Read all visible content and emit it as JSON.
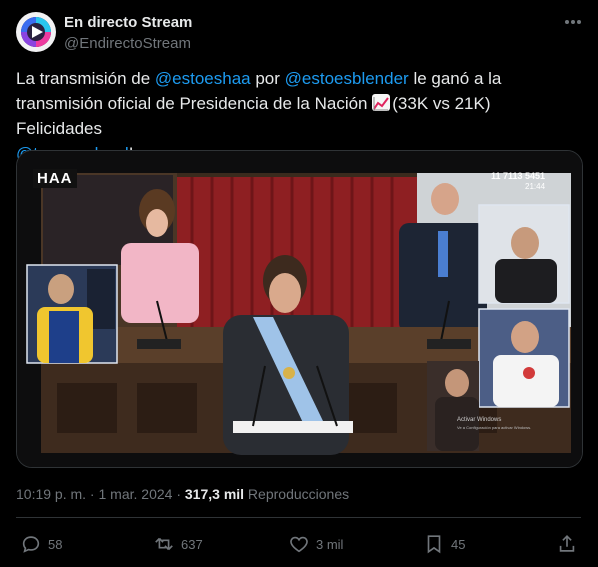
{
  "author": {
    "name": "En directo Stream",
    "handle": "@EndirectoStream"
  },
  "tweet": {
    "t1": "La transmisión de ",
    "m1": "@estoeshaa",
    "t2": " por ",
    "m2": "@estoesblender",
    "t3": " le ganó a la transmisión oficial de Presidencia de la Nación ",
    "t4": "(33K vs 21K) Felicidades",
    "m3": "@tomasrebord",
    "t5": "!"
  },
  "media": {
    "logo_text": "HAA",
    "phone_text": "11 7113 5451",
    "clock_text": "21:44",
    "watermark_line1": "Activar Windows",
    "watermark_line2": "Ve a Configuración para activar Windows."
  },
  "meta": {
    "time": "10:19 p. m.",
    "sep1": " · ",
    "date": "1 mar. 2024",
    "sep2": " · ",
    "views": "317,3 mil",
    "views_label": " Reproducciones"
  },
  "actions": {
    "replies": "58",
    "reposts": "637",
    "likes": "3 mil",
    "bookmarks": "45"
  },
  "colors": {
    "accent": "#1d9bf0",
    "background": "#000000",
    "text": "#e7e9ea",
    "muted": "#71767b",
    "border": "#2f3336"
  }
}
